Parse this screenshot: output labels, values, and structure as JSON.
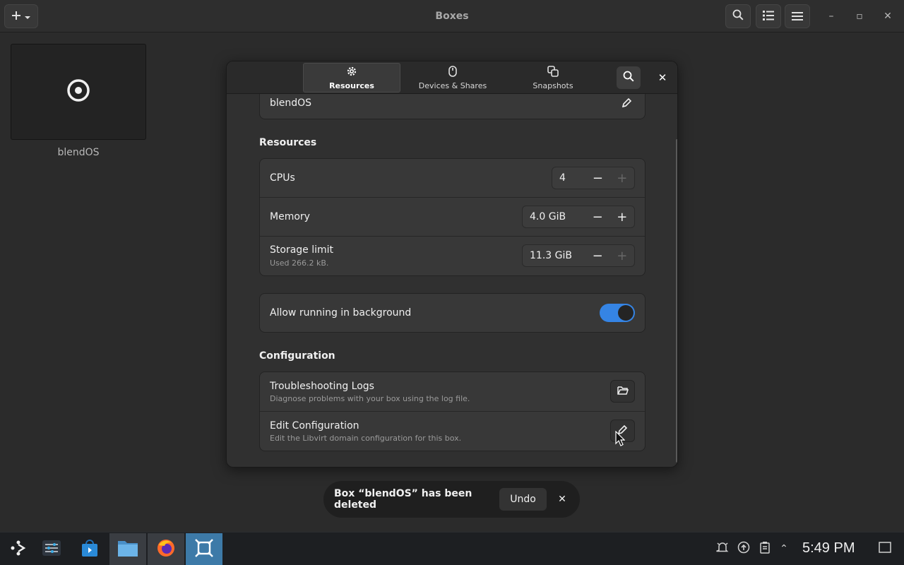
{
  "window": {
    "title": "Boxes",
    "accent": "#3584e4"
  },
  "header": {
    "add_icon": "plus-icon",
    "menu_arrow_icon": "chevron-down-icon",
    "search_icon": "search-icon",
    "view_icon": "list-view-icon",
    "menu_icon": "hamburger-menu-icon",
    "minimize": "–",
    "maximize": "▫",
    "close": "✕"
  },
  "box": {
    "name": "blendOS",
    "thumbnail_icon": "target-icon"
  },
  "dialog": {
    "tabs": [
      {
        "label": "Resources",
        "icon": "gear-icon",
        "active": true
      },
      {
        "label": "Devices & Shares",
        "icon": "mouse-icon",
        "active": false
      },
      {
        "label": "Snapshots",
        "icon": "copy-icon",
        "active": false
      }
    ],
    "name_value": "blendOS",
    "close": "✕",
    "resources_title": "Resources",
    "resources": {
      "cpus": {
        "label": "CPUs",
        "value": "4"
      },
      "memory": {
        "label": "Memory",
        "value": "4.0 GiB"
      },
      "storage": {
        "label": "Storage limit",
        "value": "11.3 GiB",
        "sub": "Used 266.2 kB."
      }
    },
    "background": {
      "label": "Allow running in background",
      "enabled": true
    },
    "configuration_title": "Configuration",
    "logs": {
      "title": "Troubleshooting Logs",
      "sub": "Diagnose problems with your box using the log file."
    },
    "edit": {
      "title": "Edit Configuration",
      "sub": "Edit the Libvirt domain configuration for this box."
    },
    "minus": "−",
    "plus": "+"
  },
  "toast": {
    "message": "Box “blendOS” has been deleted",
    "undo": "Undo",
    "close": "✕"
  },
  "taskbar": {
    "apps": [
      "app-launcher-icon",
      "settings-icon",
      "store-icon",
      "files-icon",
      "firefox-icon",
      "boxes-icon"
    ],
    "tray": [
      "notifications-icon",
      "updates-icon",
      "clipboard-icon",
      "expand-tray-icon"
    ],
    "expand": "⌃",
    "clock": "5:49 PM"
  }
}
